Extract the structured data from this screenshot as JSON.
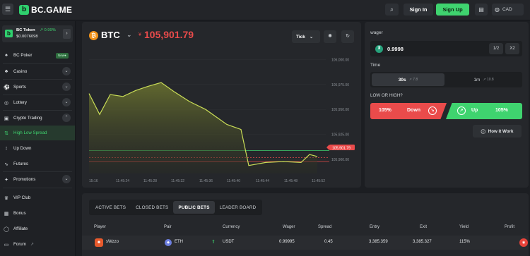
{
  "header": {
    "logo": "BC.GAME",
    "signin": "Sign In",
    "signup": "Sign Up",
    "currency": "CAD",
    "icons": [
      "menu-icon",
      "search-icon",
      "chat-icon",
      "globe-icon"
    ]
  },
  "sidebar": {
    "token": {
      "name": "BC Token",
      "change": "0.99%",
      "price": "$0.0076098"
    },
    "items": [
      {
        "label": "BC Poker",
        "tag": "New"
      },
      {
        "label": "Casino"
      },
      {
        "label": "Sports"
      },
      {
        "label": "Lottery"
      },
      {
        "label": "Crypto Trading"
      },
      {
        "label": "High Low Spread"
      },
      {
        "label": "Up Down"
      },
      {
        "label": "Futures"
      },
      {
        "label": "Promotions"
      },
      {
        "label": "VIP Club"
      },
      {
        "label": "Bonus"
      },
      {
        "label": "Affiliate"
      },
      {
        "label": "Forum"
      }
    ]
  },
  "chart": {
    "asset": "BTC",
    "price_sign": "¥",
    "price": "105,901.79",
    "tick_label": "Tick",
    "y_ticks": [
      "106,000.00",
      "105,975.00",
      "105,950.00",
      "105,925.00",
      "105,900.00"
    ],
    "current_price_tag": "105,901.79",
    "x_ticks": [
      "15:16",
      "11:45:24",
      "11:45:28",
      "11:45:32",
      "11:45:36",
      "11:45:40",
      "11:45:44",
      "11:45:48",
      "11:45:52"
    ]
  },
  "chart_data": {
    "type": "area",
    "title": "",
    "xlabel": "",
    "ylabel": "",
    "ylim": [
      105886,
      106008
    ],
    "x": [
      "11:45:20",
      "11:45:22",
      "11:45:24",
      "11:45:26",
      "11:45:28",
      "11:45:30",
      "11:45:32",
      "11:45:34",
      "11:45:36",
      "11:45:38",
      "11:45:40",
      "11:45:42",
      "11:45:44",
      "11:45:46",
      "11:45:48",
      "11:45:50",
      "11:45:52",
      "11:45:53"
    ],
    "series": [
      {
        "values": [
          105966,
          105945,
          105965,
          105963,
          105969,
          105973,
          105977,
          105968,
          105958,
          105950,
          105935,
          105930,
          105894,
          105897,
          105898,
          105897,
          105905,
          105903
        ]
      }
    ],
    "reference_lines": [
      105909,
      105901.79,
      105898
    ],
    "line_color": "#c9dc57",
    "fill_color": "#6d7530"
  },
  "wager": {
    "label": "wager",
    "value": "0.9998",
    "half": "1/2",
    "double": "X2",
    "time_label": "Time",
    "time_options": [
      {
        "label": "30s",
        "sub": "↗ 7.8"
      },
      {
        "label": "1m",
        "sub": "↗ 10.8"
      }
    ],
    "low_high_label": "LOW OR HIGH?",
    "down": {
      "pct": "105%",
      "label": "Down"
    },
    "up": {
      "pct": "105%",
      "label": "Up"
    },
    "how_it_works": "How it Work"
  },
  "bets": {
    "tabs": [
      "ACTIVE BETS",
      "CLOSED BETS",
      "PUBLIC BETS",
      "LEADER BOARD"
    ],
    "columns": [
      "Player",
      "Pair",
      "Currency",
      "Wager",
      "Spread",
      "Entry",
      "Exit",
      "Yield",
      "Profit"
    ],
    "rows": [
      {
        "player": "sWzzo",
        "pair": "ETH",
        "currency": "USDT",
        "wager": "0.99995",
        "spread": "0.45",
        "entry": "3,385.359",
        "exit": "3,385.327",
        "yield": "115%"
      }
    ]
  },
  "colors": {
    "accent": "#3fd36f",
    "down": "#ea4b4b",
    "bg": "#1c1e22",
    "panel": "#25272b"
  }
}
